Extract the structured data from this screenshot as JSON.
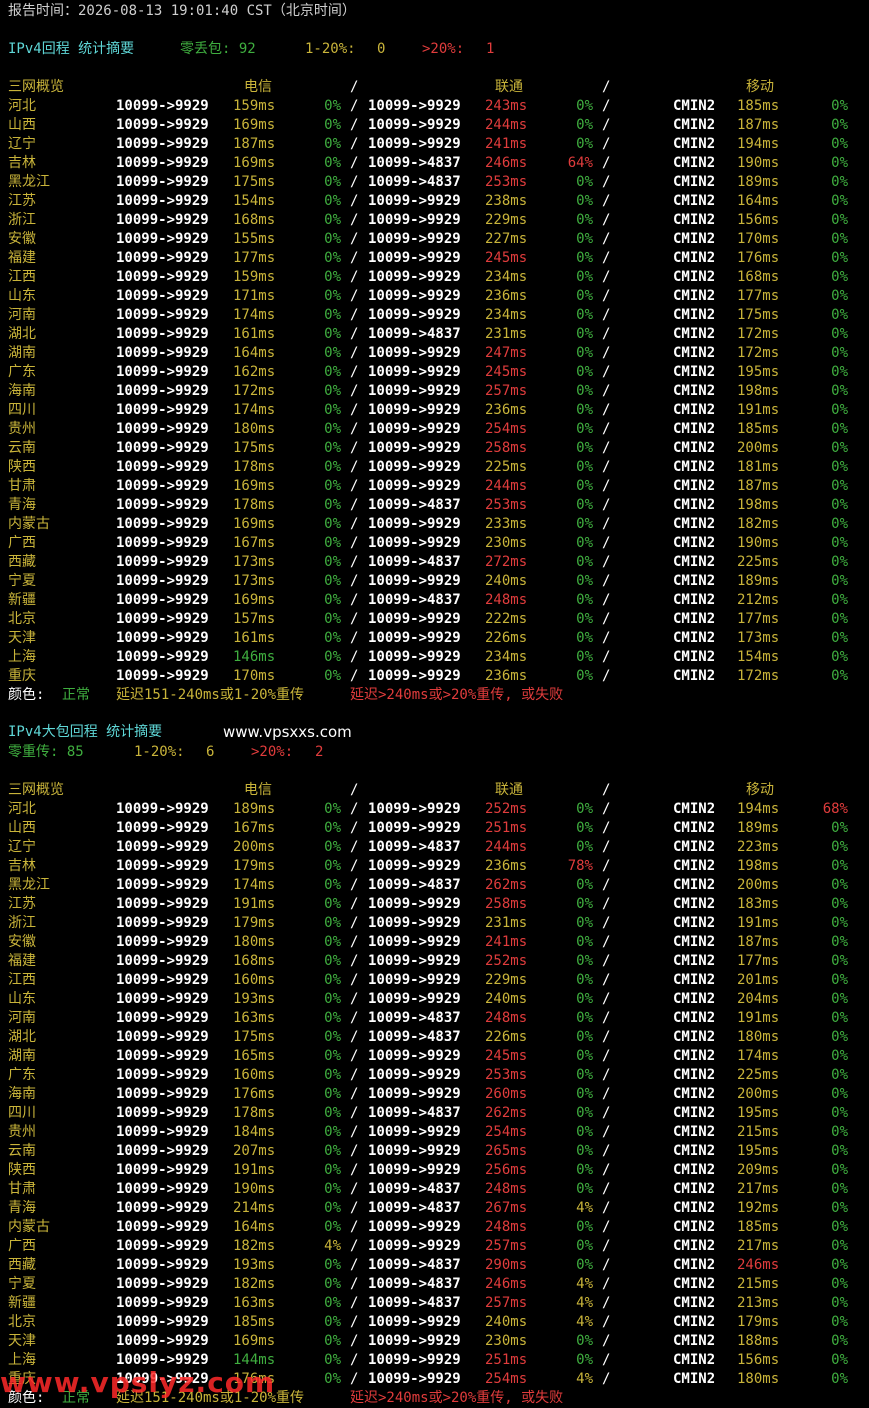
{
  "report_time": "报告时间：2026-08-13 19:01:40 CST（北京时间）",
  "colors": {
    "green": "#3fae3f",
    "yellow": "#c9b43a",
    "red": "#e03c3c",
    "cyan": "#5fd7d7"
  },
  "sections": [
    {
      "title": "IPv4回程 统计摘要",
      "site": "",
      "summary": {
        "zero_label": "零丢包: 92",
        "mid_label": "1-20%:",
        "mid_value": "0",
        "high_label": ">20%:",
        "high_value": "1"
      },
      "header": {
        "label": "三网概览",
        "telecom": "电信",
        "unicom": "联通",
        "mobile": "移动",
        "sep": "/"
      },
      "rows": [
        [
          "河北",
          "10099->9929",
          "159ms",
          "0%",
          "10099->9929",
          "243ms",
          "0%",
          "CMIN2",
          "185ms",
          "0%"
        ],
        [
          "山西",
          "10099->9929",
          "169ms",
          "0%",
          "10099->9929",
          "244ms",
          "0%",
          "CMIN2",
          "187ms",
          "0%"
        ],
        [
          "辽宁",
          "10099->9929",
          "187ms",
          "0%",
          "10099->9929",
          "241ms",
          "0%",
          "CMIN2",
          "194ms",
          "0%"
        ],
        [
          "吉林",
          "10099->9929",
          "169ms",
          "0%",
          "10099->4837",
          "246ms",
          "64%",
          "CMIN2",
          "190ms",
          "0%"
        ],
        [
          "黑龙江",
          "10099->9929",
          "175ms",
          "0%",
          "10099->4837",
          "253ms",
          "0%",
          "CMIN2",
          "189ms",
          "0%"
        ],
        [
          "江苏",
          "10099->9929",
          "154ms",
          "0%",
          "10099->9929",
          "238ms",
          "0%",
          "CMIN2",
          "164ms",
          "0%"
        ],
        [
          "浙江",
          "10099->9929",
          "168ms",
          "0%",
          "10099->9929",
          "229ms",
          "0%",
          "CMIN2",
          "156ms",
          "0%"
        ],
        [
          "安徽",
          "10099->9929",
          "155ms",
          "0%",
          "10099->9929",
          "227ms",
          "0%",
          "CMIN2",
          "170ms",
          "0%"
        ],
        [
          "福建",
          "10099->9929",
          "177ms",
          "0%",
          "10099->9929",
          "245ms",
          "0%",
          "CMIN2",
          "176ms",
          "0%"
        ],
        [
          "江西",
          "10099->9929",
          "159ms",
          "0%",
          "10099->9929",
          "234ms",
          "0%",
          "CMIN2",
          "168ms",
          "0%"
        ],
        [
          "山东",
          "10099->9929",
          "171ms",
          "0%",
          "10099->9929",
          "236ms",
          "0%",
          "CMIN2",
          "177ms",
          "0%"
        ],
        [
          "河南",
          "10099->9929",
          "174ms",
          "0%",
          "10099->9929",
          "234ms",
          "0%",
          "CMIN2",
          "175ms",
          "0%"
        ],
        [
          "湖北",
          "10099->9929",
          "161ms",
          "0%",
          "10099->4837",
          "231ms",
          "0%",
          "CMIN2",
          "172ms",
          "0%"
        ],
        [
          "湖南",
          "10099->9929",
          "164ms",
          "0%",
          "10099->9929",
          "247ms",
          "0%",
          "CMIN2",
          "172ms",
          "0%"
        ],
        [
          "广东",
          "10099->9929",
          "162ms",
          "0%",
          "10099->9929",
          "245ms",
          "0%",
          "CMIN2",
          "195ms",
          "0%"
        ],
        [
          "海南",
          "10099->9929",
          "172ms",
          "0%",
          "10099->9929",
          "257ms",
          "0%",
          "CMIN2",
          "198ms",
          "0%"
        ],
        [
          "四川",
          "10099->9929",
          "174ms",
          "0%",
          "10099->9929",
          "236ms",
          "0%",
          "CMIN2",
          "191ms",
          "0%"
        ],
        [
          "贵州",
          "10099->9929",
          "180ms",
          "0%",
          "10099->9929",
          "254ms",
          "0%",
          "CMIN2",
          "185ms",
          "0%"
        ],
        [
          "云南",
          "10099->9929",
          "175ms",
          "0%",
          "10099->9929",
          "258ms",
          "0%",
          "CMIN2",
          "200ms",
          "0%"
        ],
        [
          "陕西",
          "10099->9929",
          "178ms",
          "0%",
          "10099->9929",
          "225ms",
          "0%",
          "CMIN2",
          "181ms",
          "0%"
        ],
        [
          "甘肃",
          "10099->9929",
          "169ms",
          "0%",
          "10099->9929",
          "244ms",
          "0%",
          "CMIN2",
          "187ms",
          "0%"
        ],
        [
          "青海",
          "10099->9929",
          "178ms",
          "0%",
          "10099->4837",
          "253ms",
          "0%",
          "CMIN2",
          "198ms",
          "0%"
        ],
        [
          "内蒙古",
          "10099->9929",
          "169ms",
          "0%",
          "10099->9929",
          "233ms",
          "0%",
          "CMIN2",
          "182ms",
          "0%"
        ],
        [
          "广西",
          "10099->9929",
          "167ms",
          "0%",
          "10099->9929",
          "230ms",
          "0%",
          "CMIN2",
          "190ms",
          "0%"
        ],
        [
          "西藏",
          "10099->9929",
          "173ms",
          "0%",
          "10099->4837",
          "272ms",
          "0%",
          "CMIN2",
          "225ms",
          "0%"
        ],
        [
          "宁夏",
          "10099->9929",
          "173ms",
          "0%",
          "10099->9929",
          "240ms",
          "0%",
          "CMIN2",
          "189ms",
          "0%"
        ],
        [
          "新疆",
          "10099->9929",
          "169ms",
          "0%",
          "10099->4837",
          "248ms",
          "0%",
          "CMIN2",
          "212ms",
          "0%"
        ],
        [
          "北京",
          "10099->9929",
          "157ms",
          "0%",
          "10099->9929",
          "222ms",
          "0%",
          "CMIN2",
          "177ms",
          "0%"
        ],
        [
          "天津",
          "10099->9929",
          "161ms",
          "0%",
          "10099->9929",
          "226ms",
          "0%",
          "CMIN2",
          "173ms",
          "0%"
        ],
        [
          "上海",
          "10099->9929",
          "146ms",
          "0%",
          "10099->9929",
          "234ms",
          "0%",
          "CMIN2",
          "154ms",
          "0%"
        ],
        [
          "重庆",
          "10099->9929",
          "170ms",
          "0%",
          "10099->9929",
          "236ms",
          "0%",
          "CMIN2",
          "172ms",
          "0%"
        ]
      ],
      "legend": {
        "label": "颜色:",
        "green": "正常",
        "yellow": "延迟151-240ms或1-20%重传",
        "red": "延迟>240ms或>20%重传, 或失败"
      }
    },
    {
      "title": "IPv4大包回程 统计摘要",
      "site": "www.vpsxxs.com",
      "summary": {
        "zero_label": "零重传: 85",
        "mid_label": "1-20%:",
        "mid_value": "6",
        "high_label": ">20%:",
        "high_value": "2"
      },
      "header": {
        "label": "三网概览",
        "telecom": "电信",
        "unicom": "联通",
        "mobile": "移动",
        "sep": "/"
      },
      "rows": [
        [
          "河北",
          "10099->9929",
          "189ms",
          "0%",
          "10099->9929",
          "252ms",
          "0%",
          "CMIN2",
          "194ms",
          "68%"
        ],
        [
          "山西",
          "10099->9929",
          "167ms",
          "0%",
          "10099->9929",
          "251ms",
          "0%",
          "CMIN2",
          "189ms",
          "0%"
        ],
        [
          "辽宁",
          "10099->9929",
          "200ms",
          "0%",
          "10099->4837",
          "244ms",
          "0%",
          "CMIN2",
          "223ms",
          "0%"
        ],
        [
          "吉林",
          "10099->9929",
          "179ms",
          "0%",
          "10099->9929",
          "236ms",
          "78%",
          "CMIN2",
          "198ms",
          "0%"
        ],
        [
          "黑龙江",
          "10099->9929",
          "174ms",
          "0%",
          "10099->4837",
          "262ms",
          "0%",
          "CMIN2",
          "200ms",
          "0%"
        ],
        [
          "江苏",
          "10099->9929",
          "191ms",
          "0%",
          "10099->9929",
          "258ms",
          "0%",
          "CMIN2",
          "183ms",
          "0%"
        ],
        [
          "浙江",
          "10099->9929",
          "179ms",
          "0%",
          "10099->9929",
          "231ms",
          "0%",
          "CMIN2",
          "191ms",
          "0%"
        ],
        [
          "安徽",
          "10099->9929",
          "180ms",
          "0%",
          "10099->9929",
          "241ms",
          "0%",
          "CMIN2",
          "187ms",
          "0%"
        ],
        [
          "福建",
          "10099->9929",
          "168ms",
          "0%",
          "10099->9929",
          "252ms",
          "0%",
          "CMIN2",
          "177ms",
          "0%"
        ],
        [
          "江西",
          "10099->9929",
          "160ms",
          "0%",
          "10099->9929",
          "229ms",
          "0%",
          "CMIN2",
          "201ms",
          "0%"
        ],
        [
          "山东",
          "10099->9929",
          "193ms",
          "0%",
          "10099->9929",
          "240ms",
          "0%",
          "CMIN2",
          "204ms",
          "0%"
        ],
        [
          "河南",
          "10099->9929",
          "163ms",
          "0%",
          "10099->4837",
          "248ms",
          "0%",
          "CMIN2",
          "191ms",
          "0%"
        ],
        [
          "湖北",
          "10099->9929",
          "175ms",
          "0%",
          "10099->4837",
          "226ms",
          "0%",
          "CMIN2",
          "180ms",
          "0%"
        ],
        [
          "湖南",
          "10099->9929",
          "165ms",
          "0%",
          "10099->9929",
          "245ms",
          "0%",
          "CMIN2",
          "174ms",
          "0%"
        ],
        [
          "广东",
          "10099->9929",
          "160ms",
          "0%",
          "10099->9929",
          "253ms",
          "0%",
          "CMIN2",
          "225ms",
          "0%"
        ],
        [
          "海南",
          "10099->9929",
          "176ms",
          "0%",
          "10099->9929",
          "260ms",
          "0%",
          "CMIN2",
          "200ms",
          "0%"
        ],
        [
          "四川",
          "10099->9929",
          "178ms",
          "0%",
          "10099->4837",
          "262ms",
          "0%",
          "CMIN2",
          "195ms",
          "0%"
        ],
        [
          "贵州",
          "10099->9929",
          "184ms",
          "0%",
          "10099->9929",
          "254ms",
          "0%",
          "CMIN2",
          "215ms",
          "0%"
        ],
        [
          "云南",
          "10099->9929",
          "207ms",
          "0%",
          "10099->9929",
          "265ms",
          "0%",
          "CMIN2",
          "195ms",
          "0%"
        ],
        [
          "陕西",
          "10099->9929",
          "191ms",
          "0%",
          "10099->9929",
          "256ms",
          "0%",
          "CMIN2",
          "209ms",
          "0%"
        ],
        [
          "甘肃",
          "10099->9929",
          "190ms",
          "0%",
          "10099->4837",
          "248ms",
          "0%",
          "CMIN2",
          "217ms",
          "0%"
        ],
        [
          "青海",
          "10099->9929",
          "214ms",
          "0%",
          "10099->4837",
          "267ms",
          "4%",
          "CMIN2",
          "192ms",
          "0%"
        ],
        [
          "内蒙古",
          "10099->9929",
          "164ms",
          "0%",
          "10099->9929",
          "248ms",
          "0%",
          "CMIN2",
          "185ms",
          "0%"
        ],
        [
          "广西",
          "10099->9929",
          "182ms",
          "4%",
          "10099->9929",
          "257ms",
          "0%",
          "CMIN2",
          "217ms",
          "0%"
        ],
        [
          "西藏",
          "10099->9929",
          "193ms",
          "0%",
          "10099->4837",
          "290ms",
          "0%",
          "CMIN2",
          "246ms",
          "0%"
        ],
        [
          "宁夏",
          "10099->9929",
          "182ms",
          "0%",
          "10099->4837",
          "246ms",
          "4%",
          "CMIN2",
          "215ms",
          "0%"
        ],
        [
          "新疆",
          "10099->9929",
          "163ms",
          "0%",
          "10099->4837",
          "257ms",
          "4%",
          "CMIN2",
          "213ms",
          "0%"
        ],
        [
          "北京",
          "10099->9929",
          "185ms",
          "0%",
          "10099->9929",
          "240ms",
          "4%",
          "CMIN2",
          "179ms",
          "0%"
        ],
        [
          "天津",
          "10099->9929",
          "169ms",
          "0%",
          "10099->9929",
          "230ms",
          "0%",
          "CMIN2",
          "188ms",
          "0%"
        ],
        [
          "上海",
          "10099->9929",
          "144ms",
          "0%",
          "10099->9929",
          "251ms",
          "0%",
          "CMIN2",
          "156ms",
          "0%"
        ],
        [
          "重庆",
          "10099->9929",
          "176ms",
          "0%",
          "10099->9929",
          "254ms",
          "4%",
          "CMIN2",
          "180ms",
          "0%"
        ]
      ],
      "legend": {
        "label": "颜色:",
        "green": "正常",
        "yellow": "延迟151-240ms或1-20%重传",
        "red": "延迟>240ms或>20%重传, 或失败"
      }
    }
  ],
  "watermark": "www.vpslyz.com"
}
